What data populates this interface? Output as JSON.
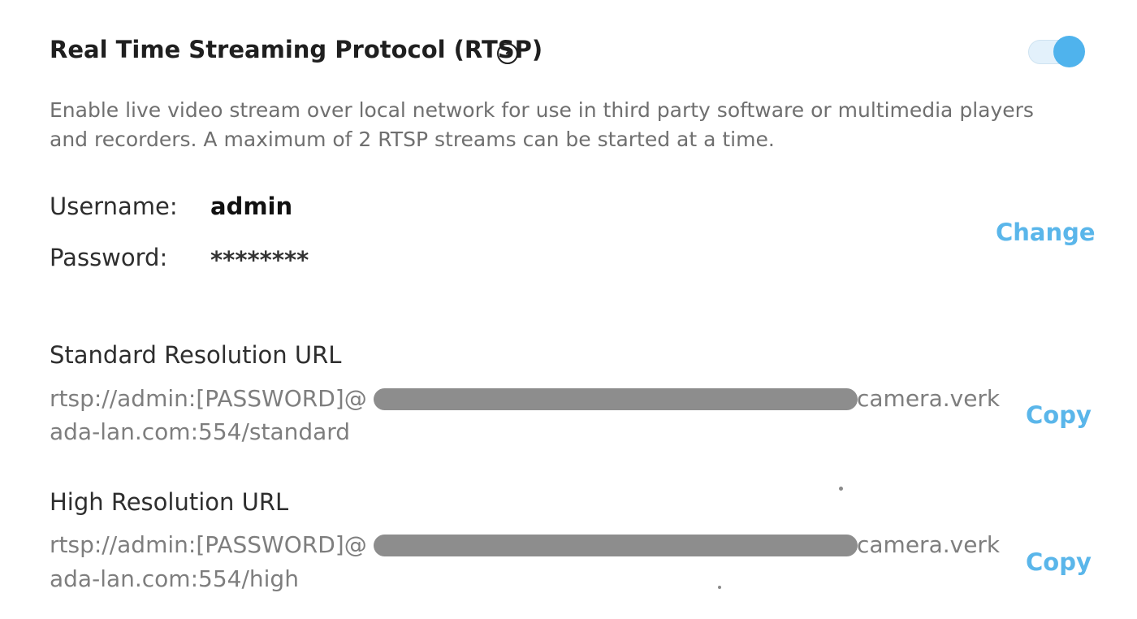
{
  "rtsp": {
    "title": "Real Time Streaming Protocol (RTSP)",
    "help_icon": "question-circle-icon",
    "help_glyph": "?",
    "enabled": true,
    "accent_color": "#4fb3ed",
    "description": "Enable live video stream over local network for use in third party software or multimedia players and recorders. A maximum of 2 RTSP streams can be started at a time."
  },
  "credentials": {
    "username_label": "Username:",
    "username_value": "admin",
    "password_label": "Password:",
    "password_value": "********",
    "change_label": "Change"
  },
  "urls": {
    "standard": {
      "heading": "Standard Resolution URL",
      "prefix": "rtsp://admin:[PASSWORD]@",
      "suffix": "camera.verk",
      "line2": "ada-lan.com:554/standard",
      "copy_label": "Copy"
    },
    "high": {
      "heading": "High Resolution URL",
      "prefix": "rtsp://admin:[PASSWORD]@",
      "suffix": "camera.verk",
      "line2": "ada-lan.com:554/high",
      "copy_label": "Copy"
    }
  }
}
